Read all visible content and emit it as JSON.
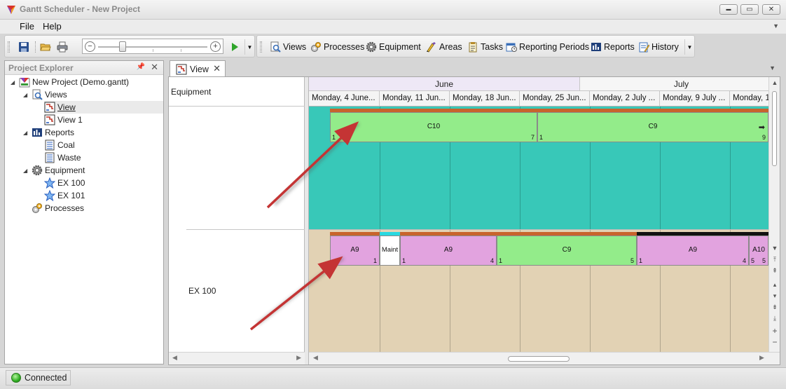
{
  "app": {
    "title": "Gantt Scheduler - New Project"
  },
  "window_controls": {
    "minimize": "▬",
    "maximize": "▭",
    "close": "✕"
  },
  "menu": [
    {
      "label": "File"
    },
    {
      "label": "Help"
    }
  ],
  "toolbar": {
    "zoom": {
      "minus": "−",
      "plus": "+",
      "level_fraction": 0.2
    },
    "buttons": [
      {
        "label": "Views",
        "icon": "views-icon"
      },
      {
        "label": "Processes",
        "icon": "processes-icon"
      },
      {
        "label": "Equipment",
        "icon": "equipment-icon"
      },
      {
        "label": "Areas",
        "icon": "areas-icon"
      },
      {
        "label": "Tasks",
        "icon": "tasks-icon"
      },
      {
        "label": "Reporting Periods",
        "icon": "reporting-periods-icon"
      },
      {
        "label": "Reports",
        "icon": "reports-icon"
      },
      {
        "label": "History",
        "icon": "history-icon"
      }
    ]
  },
  "explorer": {
    "title": "Project Explorer",
    "tree": [
      {
        "label": "New Project (Demo.gantt)",
        "icon": "project-icon"
      },
      {
        "label": "Views",
        "icon": "views-icon"
      },
      {
        "label": "View",
        "icon": "view-icon"
      },
      {
        "label": "View 1",
        "icon": "view-icon"
      },
      {
        "label": "Reports",
        "icon": "reports-icon"
      },
      {
        "label": "Coal",
        "icon": "report-icon"
      },
      {
        "label": "Waste",
        "icon": "report-icon"
      },
      {
        "label": "Equipment",
        "icon": "equipment-icon"
      },
      {
        "label": "EX 100",
        "icon": "star-icon"
      },
      {
        "label": "EX 101",
        "icon": "star-icon"
      },
      {
        "label": "Processes",
        "icon": "processes-icon"
      }
    ]
  },
  "document": {
    "tab_label": "View",
    "resource_header": "Equipment",
    "resource_name": "EX 100",
    "months": [
      "June",
      "July"
    ],
    "weeks": [
      "Monday, 4 June...",
      "Monday, 11 Jun...",
      "Monday, 18 Jun...",
      "Monday, 25 Jun...",
      "Monday, 2 July ...",
      "Monday, 9 July ...",
      "Monday, 1"
    ],
    "top_bars": [
      {
        "label": "C10",
        "start": "1",
        "end": "7"
      },
      {
        "label": "C9",
        "start": "1",
        "end": "9"
      }
    ],
    "bottom_bars": [
      {
        "label": "A9",
        "start": "",
        "end": "1"
      },
      {
        "label": "Maint",
        "start": "",
        "end": ""
      },
      {
        "label": "A9",
        "start": "1",
        "end": "4"
      },
      {
        "label": "C9",
        "start": "1",
        "end": "5"
      },
      {
        "label": "A9",
        "start": "1",
        "end": "4"
      },
      {
        "label": "A10",
        "start": "5",
        "end": "5"
      }
    ]
  },
  "status": {
    "text": "Connected"
  },
  "colors": {
    "top_lane": "#38c8b8",
    "bottom_lane": "#e2d2b4",
    "green_bar": "#93ec8a",
    "pink_bar": "#e2a3df",
    "strip_orange": "#c8642c",
    "strip_cyan": "#29d8e0",
    "strip_black": "#111111",
    "annotation_arrow": "#c43434"
  }
}
